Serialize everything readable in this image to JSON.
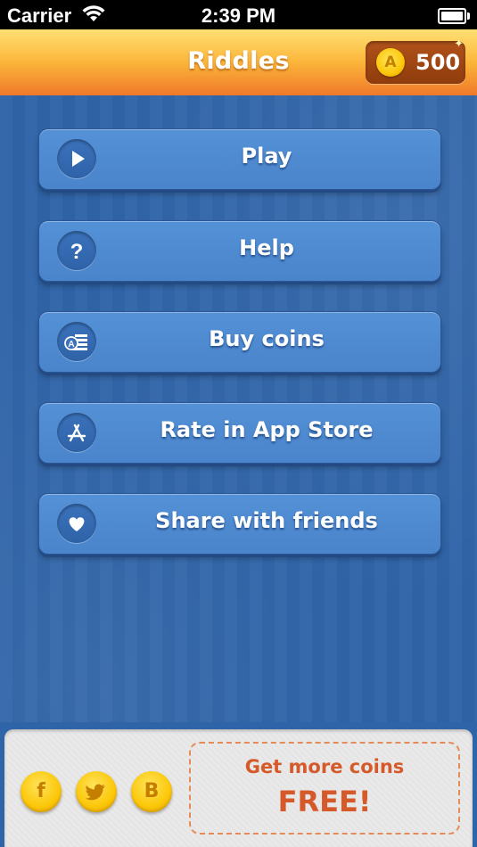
{
  "status_bar": {
    "carrier": "Carrier",
    "time": "2:39 PM",
    "icons": [
      "wifi-icon",
      "battery-icon"
    ]
  },
  "header": {
    "title": "Riddles",
    "coin_symbol": "A",
    "coins": "500"
  },
  "menu": {
    "items": [
      {
        "label": "Play",
        "icon": "play-icon"
      },
      {
        "label": "Help",
        "icon": "question-icon"
      },
      {
        "label": "Buy coins",
        "icon": "buy-coins-icon"
      },
      {
        "label": "Rate in App Store",
        "icon": "app-store-icon"
      },
      {
        "label": "Share with friends",
        "icon": "heart-icon"
      }
    ]
  },
  "footer": {
    "social": [
      {
        "icon": "facebook-icon",
        "glyph": "f"
      },
      {
        "icon": "twitter-icon"
      },
      {
        "icon": "b-icon",
        "glyph": "B"
      }
    ],
    "promo": {
      "line1": "Get more coins",
      "line2": "FREE!"
    }
  },
  "colors": {
    "header_top": "#ffe073",
    "header_bottom": "#f0792a",
    "background": "#2f64a8",
    "button": "#4a84cb",
    "coin_gold": "#fbc70a",
    "promo_text": "#d6592a"
  }
}
